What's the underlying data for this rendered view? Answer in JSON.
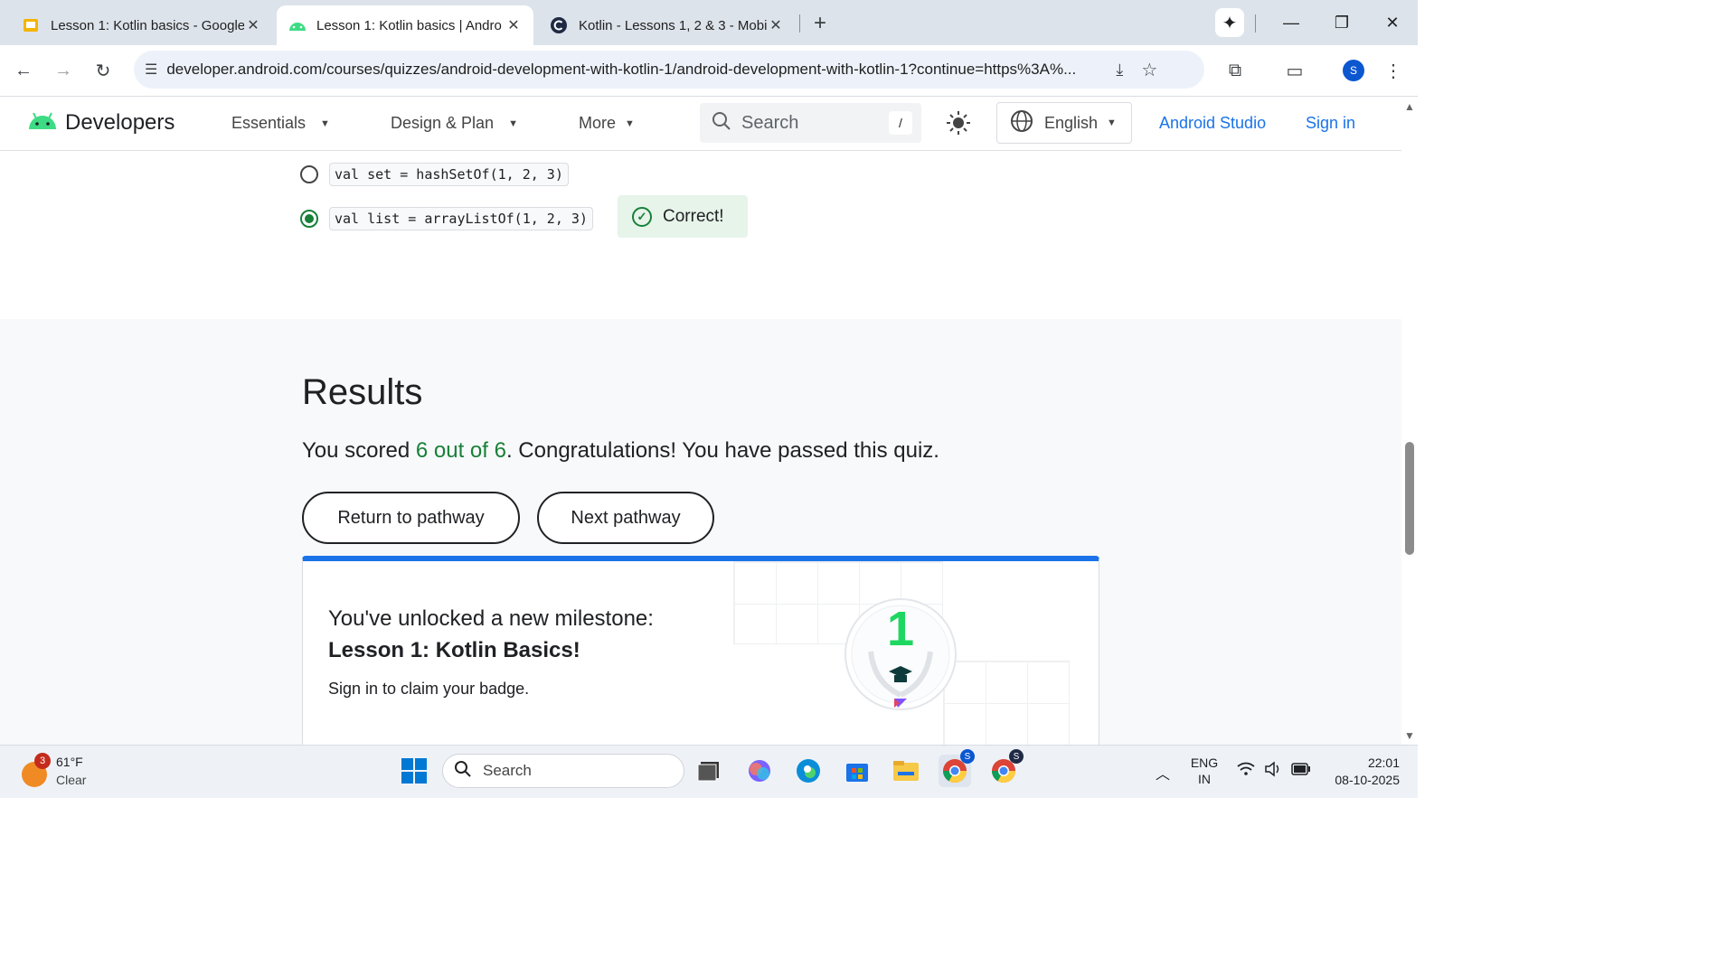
{
  "browser": {
    "tabs": [
      {
        "title": "Lesson 1: Kotlin basics - Google",
        "active": false,
        "icon": "slides-icon"
      },
      {
        "title": "Lesson 1: Kotlin basics  |  Andro",
        "active": true,
        "icon": "android-icon"
      },
      {
        "title": "Kotlin - Lessons 1, 2 & 3 - Mobi",
        "active": false,
        "icon": "coursera-icon"
      }
    ],
    "url": "developer.android.com/courses/quizzes/android-development-with-kotlin-1/android-development-with-kotlin-1?continue=https%3A%...",
    "profile_initial": "S"
  },
  "site_header": {
    "brand": "Developers",
    "nav": [
      "Essentials",
      "Design & Plan",
      "More"
    ],
    "search_placeholder": "Search",
    "search_shortcut": "/",
    "language": "English",
    "links": [
      "Android Studio",
      "Sign in"
    ]
  },
  "quiz": {
    "options": [
      {
        "code": "val set = hashSetOf(1, 2, 3)",
        "selected": false
      },
      {
        "code": "val list = arrayListOf(1, 2, 3)",
        "selected": true
      }
    ],
    "feedback": "Correct!"
  },
  "results": {
    "heading": "Results",
    "score_prefix": "You scored ",
    "score_value": "6 out of 6",
    "score_suffix": ". Congratulations! You have passed this quiz.",
    "buttons": [
      "Return to pathway",
      "Next pathway"
    ]
  },
  "milestone": {
    "line1": "You've unlocked a new milestone:",
    "line2": "Lesson 1: Kotlin Basics!",
    "line3": "Sign in to claim your badge.",
    "badge_number": "1"
  },
  "taskbar": {
    "weather_temp": "61°F",
    "weather_desc": "Clear",
    "weather_badge": "3",
    "search_placeholder": "Search",
    "lang_line1": "ENG",
    "lang_line2": "IN",
    "time": "22:01",
    "date": "08-10-2025",
    "chrome_profile": "S"
  },
  "colors": {
    "accent_blue": "#1a73e8",
    "success_green": "#188038",
    "correct_bg": "#e6f4ea"
  }
}
